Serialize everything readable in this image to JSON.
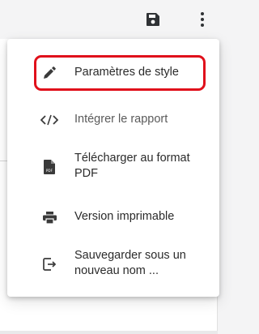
{
  "menu": {
    "items": [
      {
        "label": "Paramètres de style",
        "icon": "pencil-icon"
      },
      {
        "label": "Intégrer le rapport",
        "icon": "code-icon"
      },
      {
        "label": "Télécharger au format\nPDF",
        "icon": "pdf-file-icon",
        "icon_text": "PDF"
      },
      {
        "label": "Version imprimable",
        "icon": "printer-icon"
      },
      {
        "label": "Sauvegarder sous un\nnouveau nom ...",
        "icon": "save-as-icon"
      }
    ]
  },
  "toolbar": {
    "save_icon": "save-icon",
    "more_icon": "more-vert-icon"
  },
  "colors": {
    "highlight": "#e0101b",
    "icon": "#3a3a3a",
    "menu_bg": "#ffffff"
  }
}
